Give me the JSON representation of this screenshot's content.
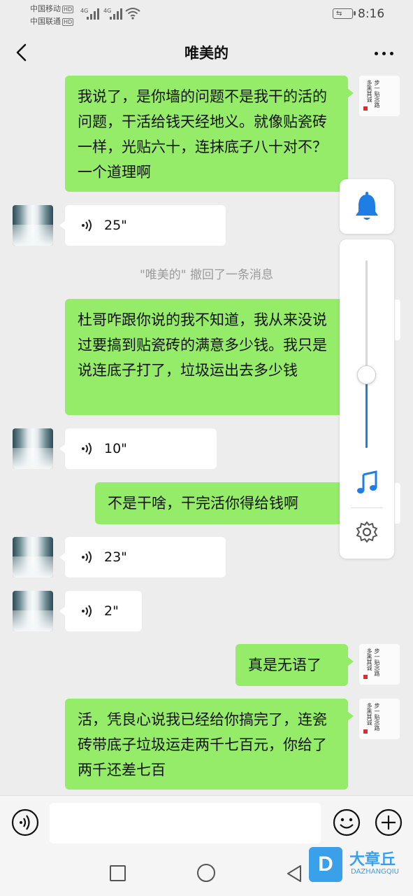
{
  "status_bar": {
    "carrier1": "中国移动",
    "carrier2": "中国联通",
    "hd_badge": "HD",
    "network": "4G",
    "time": "8:16"
  },
  "header": {
    "title": "唯美的",
    "back_icon": "chevron-left-icon",
    "more_icon": "ellipsis-icon"
  },
  "messages": [
    {
      "from": "me",
      "type": "text",
      "text": "我说了，是你墙的问题不是我干的活的问题，干活给钱天经地义。就像贴瓷砖一样，光贴六十，连抹底子八十对不？一个道理啊"
    },
    {
      "from": "them",
      "type": "voice",
      "duration": "25\""
    },
    {
      "type": "system",
      "text": "\"唯美的\" 撤回了一条消息"
    },
    {
      "from": "me",
      "type": "text",
      "text": "杜哥咋跟你说的我不知道，我从来没说过要搞到贴瓷砖的满意多少钱。我只是说连底子打了，垃圾运出去多少钱"
    },
    {
      "from": "them",
      "type": "voice",
      "duration": "10\""
    },
    {
      "from": "me",
      "type": "text",
      "text": "不是干啥，干完活你得给钱啊"
    },
    {
      "from": "them",
      "type": "voice",
      "duration": "23\""
    },
    {
      "from": "them",
      "type": "voice",
      "duration": "2\""
    },
    {
      "from": "me",
      "type": "text",
      "text": "真是无语了"
    },
    {
      "from": "me",
      "type": "text",
      "text": "活，凭良心说我已经给你搞完了，连瓷砖带底子垃圾运走两千七百元，你给了两千还差七百"
    }
  ],
  "my_avatar": {
    "calligraphy": "步一贴念路 多黑其诚"
  },
  "float_panel": {
    "bell_icon": "bell-icon",
    "volume_level": 0.39,
    "music_icon": "music-note-icon",
    "settings_icon": "gear-icon"
  },
  "input_bar": {
    "voice_icon": "voice-input-icon",
    "text_value": "",
    "emoji_icon": "emoji-icon",
    "plus_icon": "plus-icon"
  },
  "watermark": {
    "logo_letter": "D",
    "name": "大章丘",
    "sub": "DAZHANGQIU"
  },
  "colors": {
    "my_bubble": "#95ec69",
    "their_bubble": "#ffffff",
    "background": "#ededed",
    "accent_blue": "#1e7ee6"
  }
}
